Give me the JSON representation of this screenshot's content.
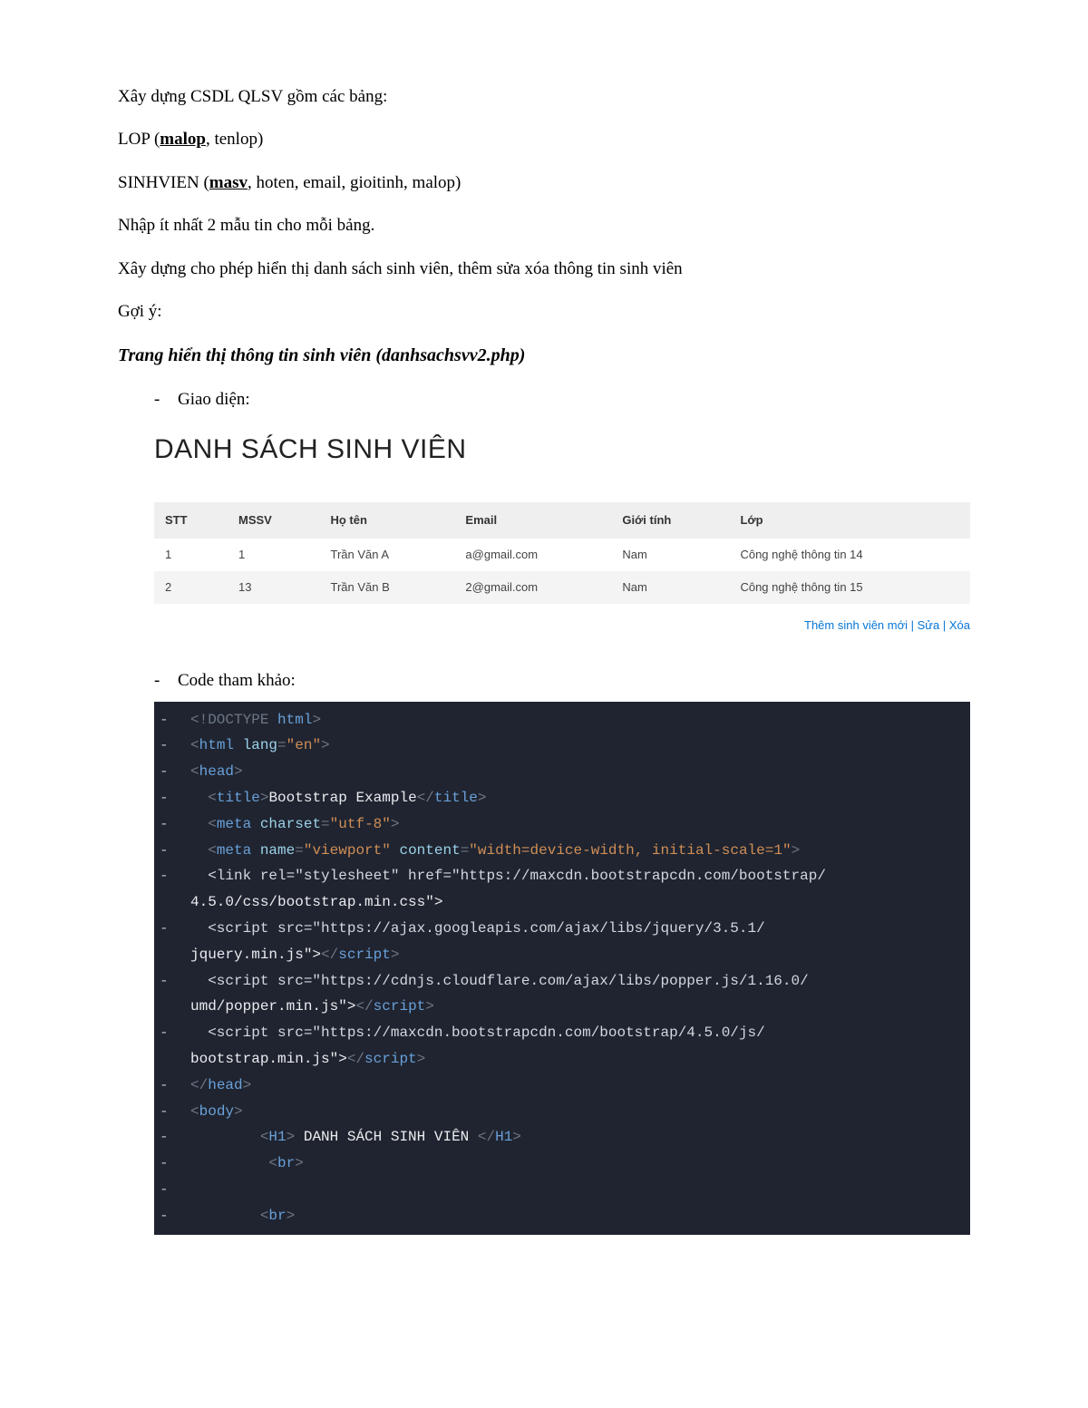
{
  "paragraphs": {
    "p1_a": "Xây dựng CSDL QLSV gồm các bảng:",
    "p2_a": "LOP (",
    "p2_key": "malop",
    "p2_b": ", tenlop)",
    "p3_a": "SINHVIEN (",
    "p3_key": "masv",
    "p3_b": ", hoten, email, gioitinh, malop)",
    "p4": "Nhập ít nhất 2 mẫu tin cho mỗi bảng.",
    "p5": "Xây dựng cho phép hiển thị danh sách sinh viên, thêm sửa xóa thông tin sinh viên",
    "p6": "Gợi ý:",
    "heading": "Trang hiển thị thông tin sinh viên (danhsachsvv2.php)",
    "bullet1": "Giao diện:",
    "bullet2": "Code tham khảo:"
  },
  "ui": {
    "title": "DANH SÁCH SINH VIÊN",
    "columns": [
      "STT",
      "MSSV",
      "Họ tên",
      "Email",
      "Giới tính",
      "Lớp"
    ],
    "rows": [
      [
        "1",
        "1",
        "Trần Văn A",
        "a@gmail.com",
        "Nam",
        "Công nghệ thông tin 14"
      ],
      [
        "2",
        "13",
        "Trần Văn B",
        "2@gmail.com",
        "Nam",
        "Công nghệ thông tin 15"
      ]
    ],
    "links": {
      "add": "Thêm sinh viên mới",
      "edit": "Sửa",
      "delete": "Xóa"
    }
  },
  "code": [
    "<!DOCTYPE html>",
    "<html lang=\"en\">",
    "<head>",
    "  <title>Bootstrap Example</title>",
    "  <meta charset=\"utf-8\">",
    "  <meta name=\"viewport\" content=\"width=device-width, initial-scale=1\">",
    "  <link rel=\"stylesheet\" href=\"https://maxcdn.bootstrapcdn.com/bootstrap/4.5.0/css/bootstrap.min.css\">",
    "  <script src=\"https://ajax.googleapis.com/ajax/libs/jquery/3.5.1/jquery.min.js\"></script>",
    "  <script src=\"https://cdnjs.cloudflare.com/ajax/libs/popper.js/1.16.0/umd/popper.min.js\"></script>",
    "  <script src=\"https://maxcdn.bootstrapcdn.com/bootstrap/4.5.0/js/bootstrap.min.js\"></script>",
    "</head>",
    "<body>",
    "        <H1> DANH SÁCH SINH VIÊN </H1>",
    "         <br>",
    "",
    "        <br>"
  ],
  "bullet_marker": "-",
  "sep": " | "
}
